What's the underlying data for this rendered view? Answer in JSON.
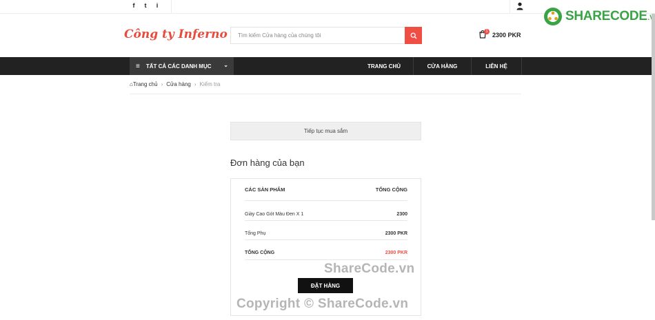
{
  "topbar": {
    "social": [
      "f",
      "t",
      "i"
    ],
    "icons": {
      "facebook": "facebook-icon",
      "twitter": "twitter-icon",
      "instagram": "instagram-icon",
      "user": "user-icon"
    }
  },
  "watermark": {
    "logo_main": "SHARECODE",
    "logo_suffix": ".vn",
    "text1": "ShareCode.vn",
    "text2": "Copyright © ShareCode.vn"
  },
  "header": {
    "logo": "Công ty Inferno",
    "search_placeholder": "Tìm kiếm Cửa hàng của chúng tôi",
    "cart_count": "1",
    "cart_total": "2300 PKR"
  },
  "nav": {
    "categories_label": "TẤT CẢ CÁC DANH MỤC",
    "items": [
      "TRANG CHỦ",
      "CỬA HÀNG",
      "LIÊN HỆ"
    ]
  },
  "breadcrumb": {
    "home": "Trang chủ",
    "shop": "Cửa hàng",
    "current": "Kiểm tra",
    "separator": "›"
  },
  "checkout": {
    "continue_label": "Tiếp tục mua sắm",
    "order_title": "Đơn hàng của bạn",
    "head_products": "CÁC SẢN PHẨM",
    "head_total": "TỔNG CỘNG",
    "item_name": "Giày Cao Gót Màu Đen X 1",
    "item_price": "2300",
    "subtotal_label": "Tổng Phụ",
    "subtotal_value": "2300 PKR",
    "total_label": "TỔNG CỘNG",
    "total_value": "2300 PKR",
    "place_order": "ĐẶT HÀNG"
  },
  "colors": {
    "accent": "#f04e45",
    "nav_bg": "#222222",
    "brand_green": "#3aa346"
  }
}
